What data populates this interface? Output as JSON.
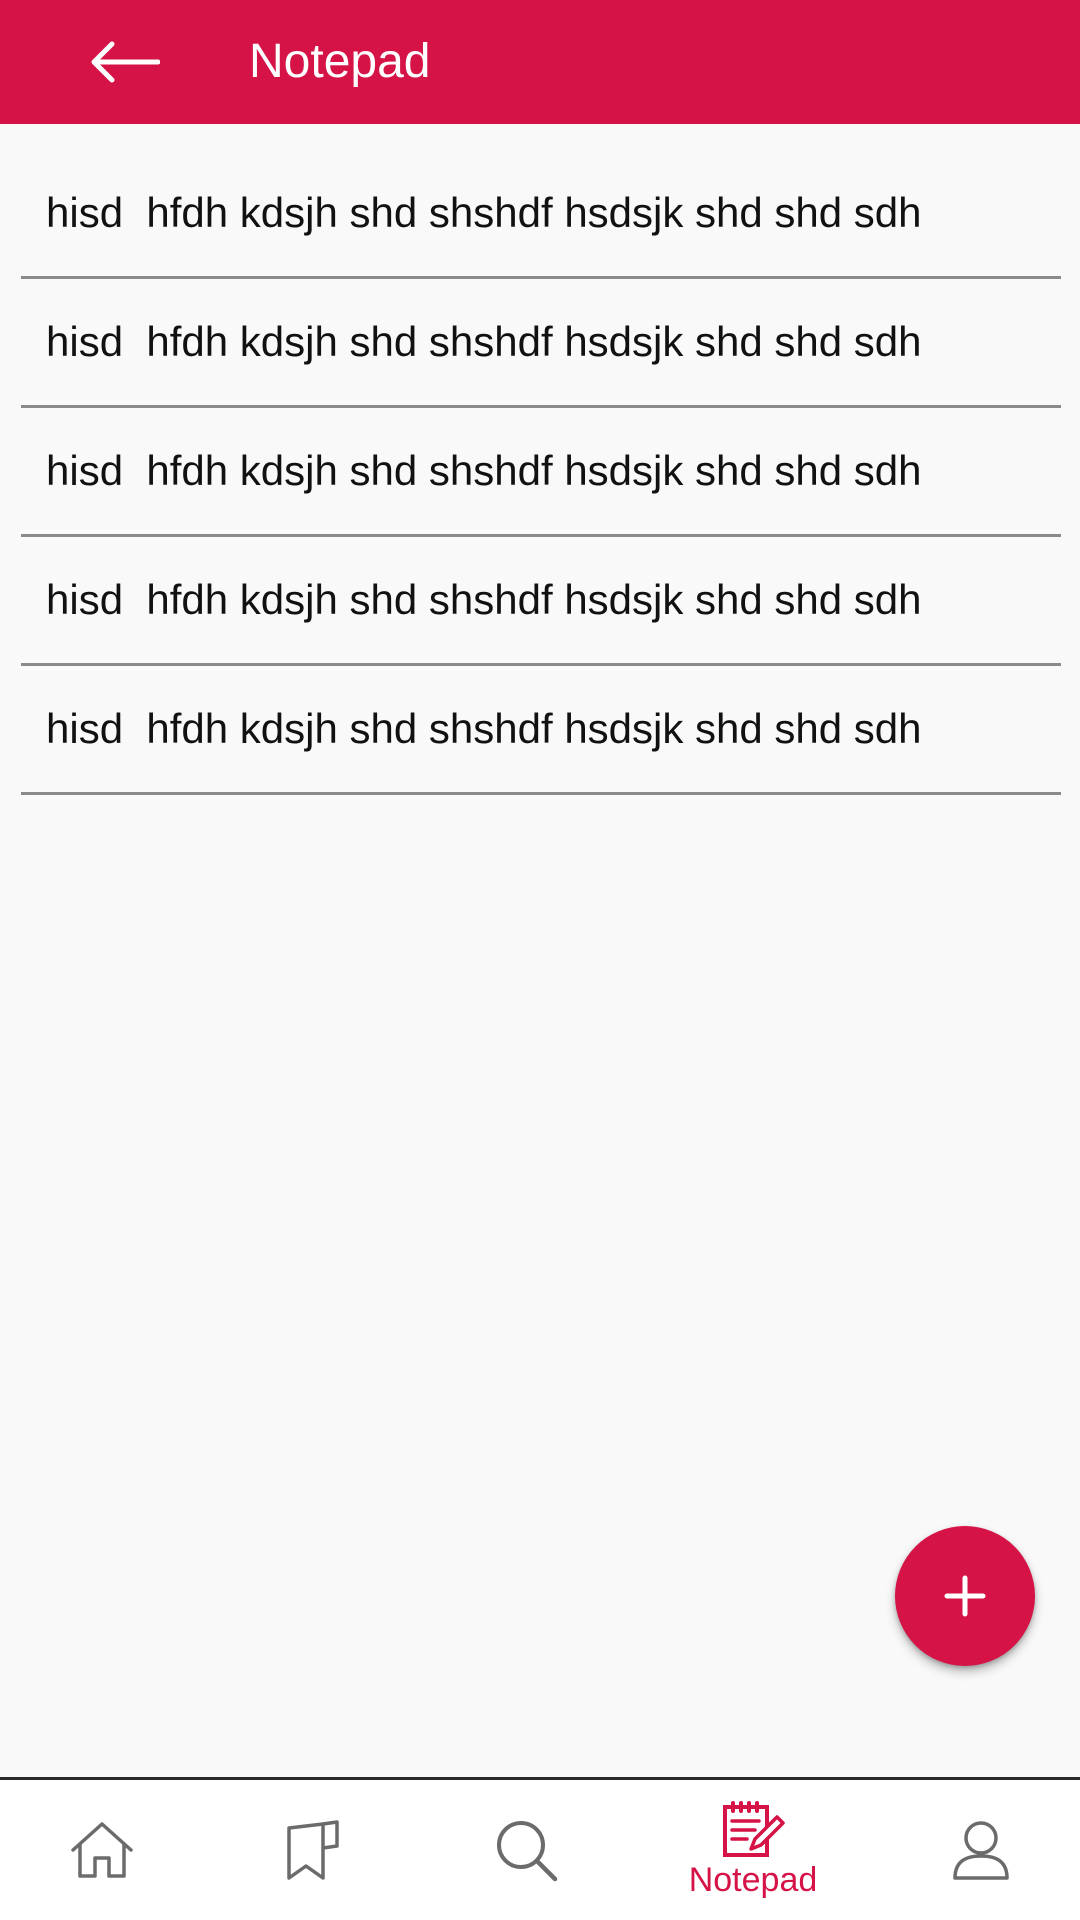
{
  "header": {
    "title": "Notepad",
    "back_icon": "arrow-left-icon"
  },
  "colors": {
    "accent": "#d51346",
    "background": "#f9f9f9",
    "divider": "#8a8a8a",
    "nav_inactive": "#6b6b6b"
  },
  "notes": [
    {
      "text": "hisd  hfdh kdsjh shd shshdf hsdsjk shd shd sdh"
    },
    {
      "text": "hisd  hfdh kdsjh shd shshdf hsdsjk shd shd sdh"
    },
    {
      "text": "hisd  hfdh kdsjh shd shshdf hsdsjk shd shd sdh"
    },
    {
      "text": "hisd  hfdh kdsjh shd shshdf hsdsjk shd shd sdh"
    },
    {
      "text": "hisd  hfdh kdsjh shd shshdf hsdsjk shd shd sdh"
    }
  ],
  "fab": {
    "icon": "plus-icon"
  },
  "bottom_nav": {
    "items": [
      {
        "icon": "home-icon",
        "label": ""
      },
      {
        "icon": "bookmark-icon",
        "label": ""
      },
      {
        "icon": "search-icon",
        "label": ""
      },
      {
        "icon": "notepad-icon",
        "label": "Notepad",
        "active": true
      },
      {
        "icon": "profile-icon",
        "label": ""
      }
    ]
  }
}
